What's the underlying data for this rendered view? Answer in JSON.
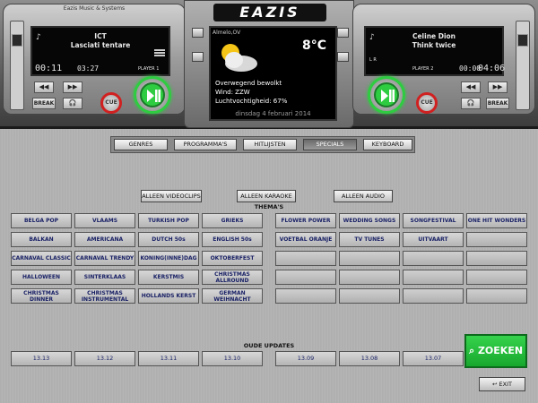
{
  "app": {
    "brand": "Eazis Music & Systems",
    "logo": "EAZIS"
  },
  "player1": {
    "artist": "ICT",
    "title": "Lasciati tentare",
    "elapsed": "00:11",
    "remaining": "03:27",
    "label": "PLAYER 1",
    "break_label": "BREAK",
    "cue_label": "CUE",
    "lr": "L R"
  },
  "player2": {
    "artist": "Celine Dion",
    "title": "Think twice",
    "elapsed": "00:00",
    "remaining": "04:06",
    "label": "PLAYER 2",
    "break_label": "BREAK",
    "cue_label": "CUE",
    "lr": "L R"
  },
  "weather": {
    "location": "Almelo,OV",
    "temperature": "8°C",
    "line1": "Overwegend bewolkt",
    "line2": "Wind: ZZW",
    "line3": "Luchtvochtigheid: 67%",
    "date": "dinsdag 4 februari 2014"
  },
  "tabs": [
    "GENRES",
    "PROGRAMMA'S",
    "HITLIJSTEN",
    "SPECIALS",
    "KEYBOARD"
  ],
  "active_tab": "SPECIALS",
  "filters": [
    "ALLEEN VIDEOCLIPS",
    "ALLEEN KARAOKE",
    "ALLEEN AUDIO"
  ],
  "themas_title": "THEMA'S",
  "themes": [
    [
      "BELGA POP",
      "VLAAMS",
      "TURKISH POP",
      "GRIEKS",
      "FLOWER POWER",
      "WEDDING SONGS",
      "SONGFESTIVAL",
      "ONE HIT WONDERS"
    ],
    [
      "BALKAN",
      "AMERICANA",
      "DUTCH 50s",
      "ENGLISH 50s",
      "VOETBAL ORANJE",
      "TV TUNES",
      "UITVAART",
      ""
    ],
    [
      "CARNAVAL CLASSIC",
      "CARNAVAL TRENDY",
      "KONING(INNE)DAG",
      "OKTOBERFEST",
      "",
      "",
      "",
      ""
    ],
    [
      "HALLOWEEN",
      "SINTERKLAAS",
      "KERSTMIS",
      "CHRISTMAS ALLROUND",
      "",
      "",
      "",
      ""
    ],
    [
      "CHRISTMAS DINNER",
      "CHRISTMAS INSTRUMENTAL",
      "HOLLANDS KERST",
      "GERMAN WEIHNACHT",
      "",
      "",
      "",
      ""
    ]
  ],
  "updates_title": "OUDE UPDATES",
  "updates": [
    "13.13",
    "13.12",
    "13.11",
    "13.10",
    "13.09",
    "13.08",
    "13.07"
  ],
  "search_label": "ZOEKEN",
  "exit_label": "EXIT",
  "colors": {
    "accent_green": "#2ecc40",
    "cue_red": "#d02020",
    "button_text": "#1a2266"
  }
}
